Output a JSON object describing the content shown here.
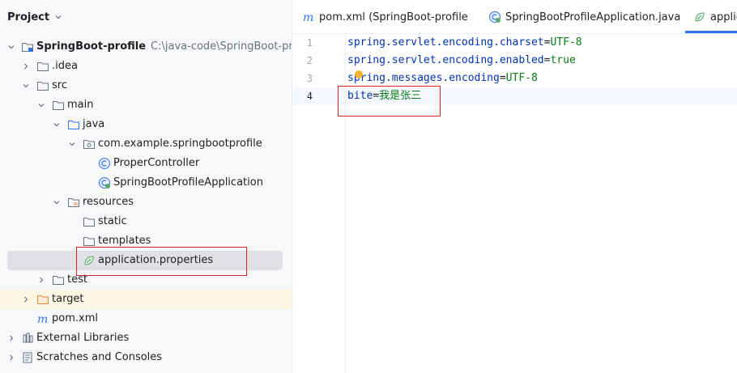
{
  "project_panel": {
    "title": "Project",
    "tree": [
      {
        "label": "SpringBoot-profile",
        "path": "C:\\java-code\\SpringBoot-profile",
        "icon": "module-folder-icon",
        "expanded": true
      },
      {
        "label": ".idea",
        "icon": "folder-icon",
        "expanded": false
      },
      {
        "label": "src",
        "icon": "folder-icon",
        "expanded": true
      },
      {
        "label": "main",
        "icon": "folder-icon",
        "expanded": true
      },
      {
        "label": "java",
        "icon": "source-folder-icon",
        "expanded": true
      },
      {
        "label": "com.example.springbootprofile",
        "icon": "package-icon",
        "expanded": true
      },
      {
        "label": "ProperController",
        "icon": "class-icon"
      },
      {
        "label": "SpringBootProfileApplication",
        "icon": "spring-boot-class-icon"
      },
      {
        "label": "resources",
        "icon": "resources-folder-icon",
        "expanded": true
      },
      {
        "label": "static",
        "icon": "folder-icon"
      },
      {
        "label": "templates",
        "icon": "folder-icon"
      },
      {
        "label": "application.properties",
        "icon": "spring-properties-icon",
        "selected": true
      },
      {
        "label": "test",
        "icon": "folder-icon",
        "expanded": false
      },
      {
        "label": "target",
        "icon": "excluded-folder-icon",
        "expanded": false
      },
      {
        "label": "pom.xml",
        "icon": "maven-icon"
      },
      {
        "label": "External Libraries",
        "icon": "libraries-icon",
        "expanded": false
      },
      {
        "label": "Scratches and Consoles",
        "icon": "scratches-icon",
        "expanded": false
      }
    ]
  },
  "editor": {
    "tabs": [
      {
        "label": "pom.xml (SpringBoot-profile",
        "icon": "maven-icon"
      },
      {
        "label": "SpringBootProfileApplication.java",
        "icon": "spring-boot-class-icon"
      },
      {
        "label": "applic",
        "icon": "spring-properties-icon",
        "active": true
      }
    ],
    "lines": [
      {
        "number": "1",
        "key": "spring.servlet.encoding.charset",
        "sep": "=",
        "value": "UTF-8"
      },
      {
        "number": "2",
        "key": "spring.servlet.encoding.enabled",
        "sep": "=",
        "value": "true"
      },
      {
        "number": "3",
        "key": "spring.messages.encoding",
        "sep": "=",
        "value": "UTF-8"
      },
      {
        "number": "4",
        "key": "bite",
        "sep": "=",
        "value": "我是张三"
      }
    ]
  },
  "colors": {
    "key": "#0033b3",
    "value": "#067d17",
    "highlight_box": "#d92323",
    "selection": "#dfe1e5",
    "excluded_row": "#fdf6e3",
    "active_tab_underline": "#3574f0"
  }
}
